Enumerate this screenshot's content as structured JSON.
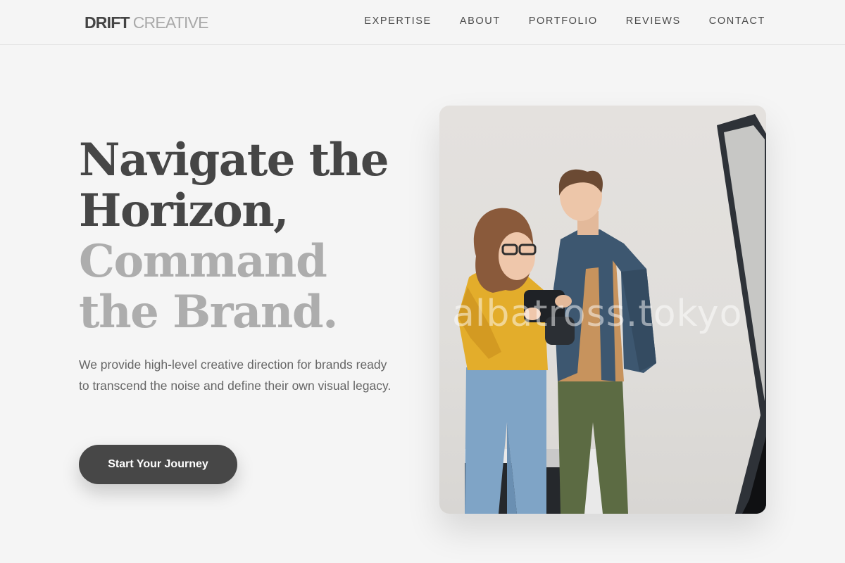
{
  "header": {
    "logo": {
      "strong": "DRIFT",
      "light": "CREATIVE"
    },
    "nav": [
      {
        "label": "EXPERTISE"
      },
      {
        "label": "ABOUT"
      },
      {
        "label": "PORTFOLIO"
      },
      {
        "label": "REVIEWS"
      },
      {
        "label": "CONTACT"
      }
    ]
  },
  "hero": {
    "headline": {
      "dark_lines": [
        "Navigate the",
        "Horizon,"
      ],
      "light_lines": [
        "Command",
        "the Brand."
      ]
    },
    "lede": "We provide high-level creative direction for brands ready to transcend the noise and define their own visual legacy.",
    "cta_label": "Start Your Journey",
    "image": {
      "subject": "two people in a photo studio looking at a camera",
      "watermark": "albatross.tokyo"
    }
  },
  "colors": {
    "background": "#f5f5f5",
    "text_dark": "#464646",
    "text_light": "#adadad",
    "button": "#474747"
  }
}
